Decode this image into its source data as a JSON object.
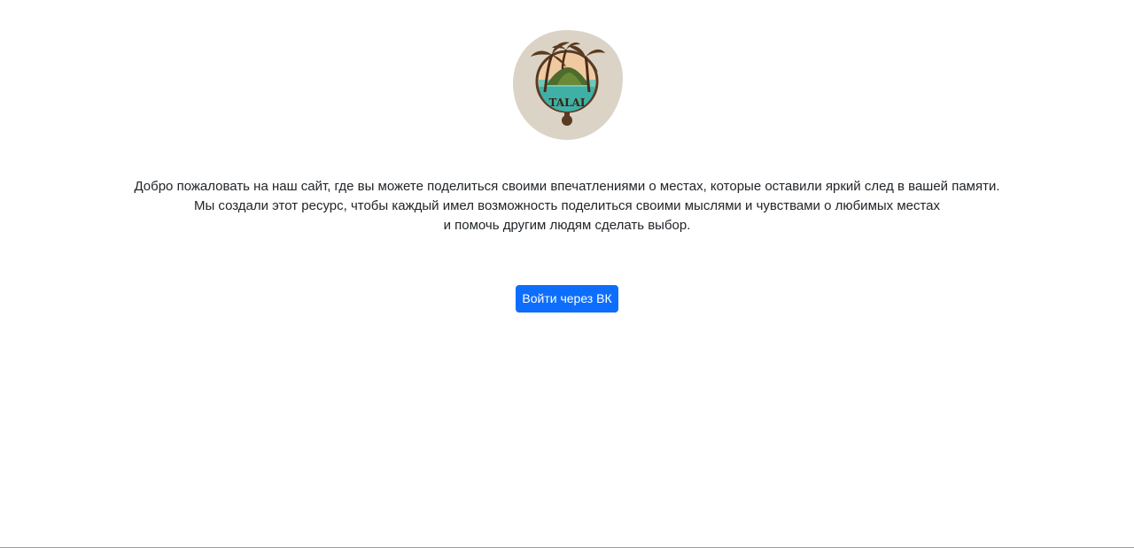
{
  "logo": {
    "text": "TALAI",
    "icon": "island-palm-logo"
  },
  "intro": {
    "line1": "Добро пожаловать на наш сайт, где вы можете поделиться своими впечатлениями о местах, которые оставили яркий след в вашей памяти.",
    "line2": "Мы создали этот ресурс, чтобы каждый имел возможность поделиться своими мыслями и чувствами о любимых местах",
    "line3": "и помочь другим людям сделать выбор."
  },
  "login_button": {
    "label": "Войти через ВК",
    "color": "#0d6efd"
  }
}
